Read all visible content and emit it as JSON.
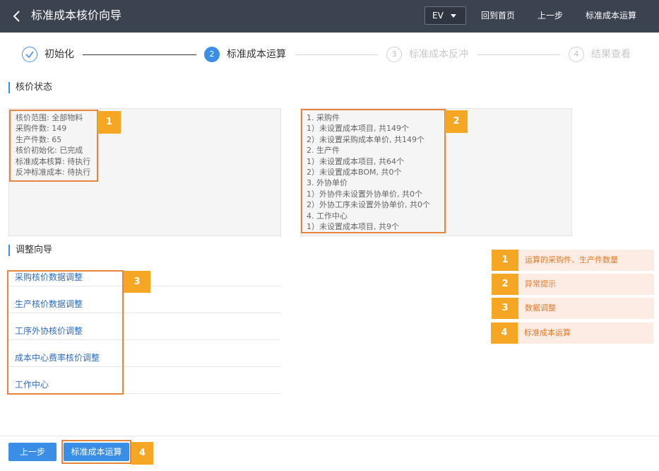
{
  "header": {
    "title": "标准成本核价向导",
    "ev_select": "EV",
    "links": [
      "回到首页",
      "上一步",
      "标准成本运算"
    ]
  },
  "steps": [
    {
      "label": "初始化",
      "state": "done"
    },
    {
      "number": "2",
      "label": "标准成本运算",
      "state": "active"
    },
    {
      "number": "3",
      "label": "标准成本反冲",
      "state": "todo"
    },
    {
      "number": "4",
      "label": "结果查看",
      "state": "todo"
    }
  ],
  "status": {
    "section_title": "核价状态",
    "left_lines": [
      "核价范围: 全部物料",
      "采购件数: 149",
      "生产件数: 65",
      "核价初始化: 已完成",
      "标准成本核算: 待执行",
      "反冲标准成本: 待执行"
    ],
    "right_lines": [
      "1. 采购件",
      "1）未设置成本项目, 共149个",
      "2）未设置采购成本单价, 共149个",
      "2. 生产件",
      "1）未设置成本项目, 共64个",
      "2）未设置成本BOM, 共0个",
      "3. 外协单价",
      "1）外协件未设置外协单价, 共0个",
      "2）外协工序未设置外协单价, 共0个",
      "4. 工作中心",
      "1）未设置成本项目, 共9个"
    ]
  },
  "adjust": {
    "section_title": "调整向导",
    "items": [
      "采购核价数据调整",
      "生产核价数据调整",
      "工序外协核价调整",
      "成本中心费率核价调整",
      "工作中心"
    ]
  },
  "badges": [
    "1",
    "2",
    "3",
    "4"
  ],
  "legend": [
    {
      "number": "1",
      "text": "运算的采购件、生产件数量"
    },
    {
      "number": "2",
      "text": "异常提示"
    },
    {
      "number": "3",
      "text": "数据调整"
    },
    {
      "number": "4",
      "text": "标准成本运算"
    }
  ],
  "footer": {
    "prev_label": "上一步",
    "run_label": "标准成本运算"
  },
  "colors": {
    "header_bg": "#3b4250",
    "primary": "#3a8ee6",
    "annotation_orange": "#f5a623",
    "annotation_border": "#e8843c",
    "link_blue": "#2d6dbf"
  }
}
